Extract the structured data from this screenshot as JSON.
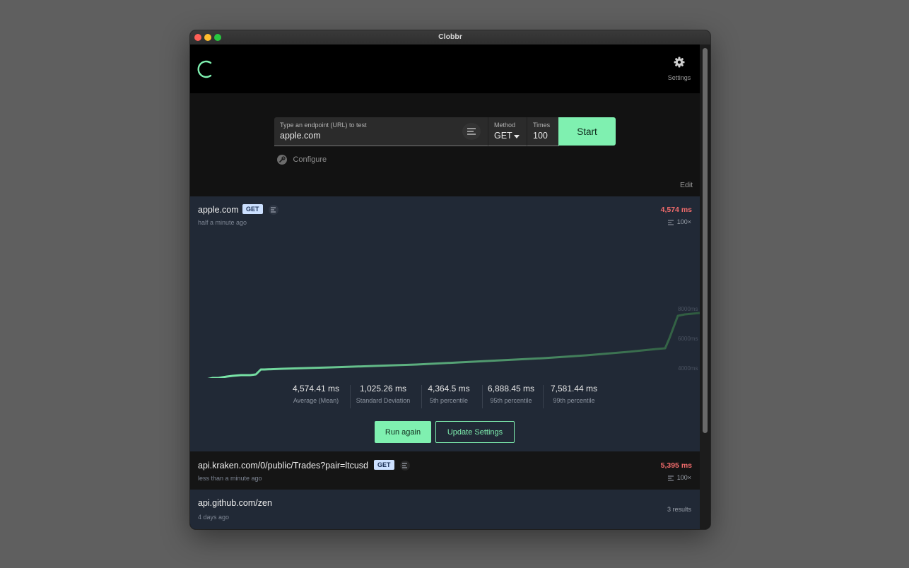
{
  "window": {
    "title": "Clobbr"
  },
  "header": {
    "settings_label": "Settings"
  },
  "form": {
    "url_label": "Type an endpoint (URL) to test",
    "url_value": "apple.com",
    "method_label": "Method",
    "method_value": "GET",
    "times_label": "Times",
    "times_value": "100",
    "start_label": "Start",
    "configure_label": "Configure"
  },
  "edit_label": "Edit",
  "colors": {
    "accent": "#7ff0b0",
    "danger": "#f06b6b",
    "card": "#212936",
    "badge": "#cce0ff"
  },
  "results": [
    {
      "url": "apple.com",
      "method": "GET",
      "time_ago": "half a minute ago",
      "duration": "4,574 ms",
      "iterations": "100×",
      "expanded": true,
      "y_ticks": [
        "8000ms",
        "6000ms",
        "4000ms",
        "2000ms"
      ],
      "stats": [
        {
          "value": "4,574.41 ms",
          "label": "Average (Mean)"
        },
        {
          "value": "1,025.26 ms",
          "label": "Standard Deviation"
        },
        {
          "value": "4,364.5 ms",
          "label": "5th percentile"
        },
        {
          "value": "6,888.45 ms",
          "label": "95th percentile"
        },
        {
          "value": "7,581.44 ms",
          "label": "99th percentile"
        }
      ],
      "run_again_label": "Run again",
      "update_settings_label": "Update Settings"
    },
    {
      "url": "api.kraken.com/0/public/Trades?pair=ltcusd",
      "method": "GET",
      "time_ago": "less than a minute ago",
      "duration": "5,395 ms",
      "iterations": "100×"
    },
    {
      "url": "api.github.com/zen",
      "time_ago": "4 days ago",
      "results_count": "3 results"
    }
  ]
}
